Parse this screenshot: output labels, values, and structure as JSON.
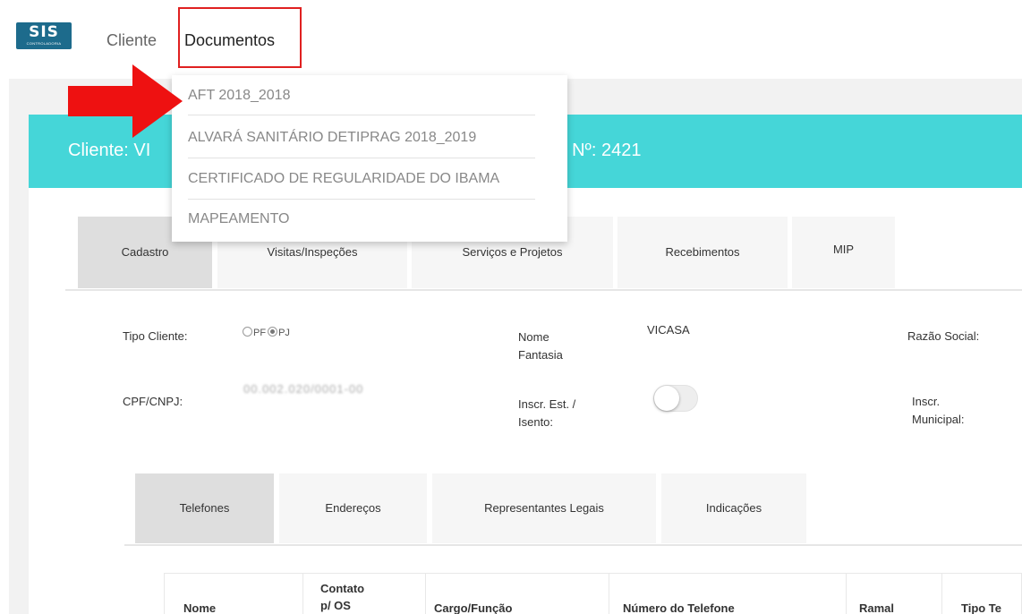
{
  "brand": {
    "logo_text": "SIS",
    "logo_subtext": "CONTROLADORIA"
  },
  "nav": {
    "items": [
      "Cliente",
      "Documentos"
    ]
  },
  "dropdown": {
    "items": [
      "AFT 2018_2018",
      "ALVARÁ SANITÁRIO DETIPRAG 2018_2019",
      "CERTIFICADO DE REGULARIDADE DO IBAMA",
      "MAPEAMENTO"
    ]
  },
  "client": {
    "title_left": "Cliente: VI",
    "title_right": "BR | Nº: 2421"
  },
  "tabs": [
    "Cadastro",
    "Visitas/Inspeções",
    "Serviços e Projetos",
    "Recebimentos",
    "MIP"
  ],
  "form": {
    "tipo_cliente_label": "Tipo Cliente:",
    "radio_pf": "PF",
    "radio_pj": "PJ",
    "nome_fantasia_label": "Nome Fantasia",
    "nome_fantasia_value": "VICASA",
    "razao_social_label": "Razão Social:",
    "cpf_cnpj_label": "CPF/CNPJ:",
    "cpf_cnpj_value": "00.002.020/0001-00",
    "inscr_est_label": "Inscr. Est. / Isento:",
    "inscr_municipal_label": "Inscr. Municipal:"
  },
  "subtabs": [
    "Telefones",
    "Endereços",
    "Representantes Legais",
    "Indicações"
  ],
  "table": {
    "headers": [
      "Nome",
      "Contato p/ OS",
      "Cargo/Função",
      "Número do Telefone",
      "Ramal",
      "Tipo Te"
    ]
  },
  "colors": {
    "teal": "#45d6d8",
    "highlight": "#e02020",
    "logo_bg": "#1d6b8c"
  }
}
